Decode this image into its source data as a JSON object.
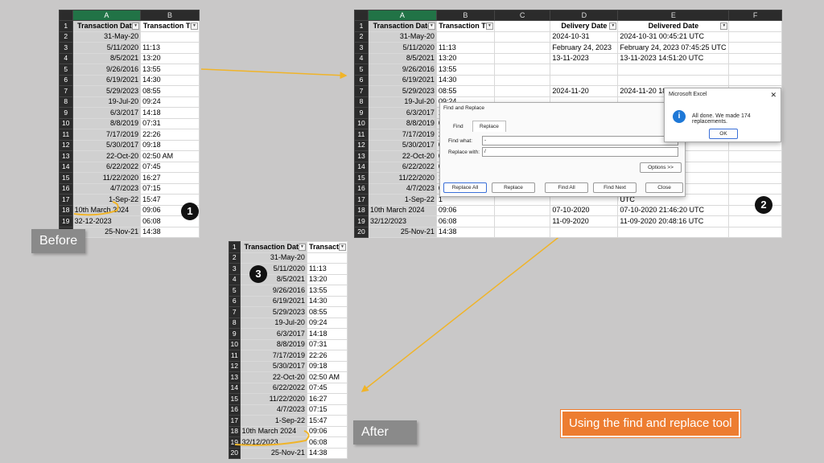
{
  "colors": {
    "arrow": "#f0b429",
    "accent": "#ed7d31",
    "excel_green": "#217346"
  },
  "panel1": {
    "col_letters": [
      "A",
      "B"
    ],
    "headers": [
      "Transaction Date",
      "Transaction Tin"
    ],
    "rows": [
      [
        "31-May-20",
        ""
      ],
      [
        "5/11/2020",
        "11:13"
      ],
      [
        "8/5/2021",
        "13:20"
      ],
      [
        "9/26/2016",
        "13:55"
      ],
      [
        "6/19/2021",
        "14:30"
      ],
      [
        "5/29/2023",
        "08:55"
      ],
      [
        "19-Jul-20",
        "09:24"
      ],
      [
        "6/3/2017",
        "14:18"
      ],
      [
        "8/8/2019",
        "07:31"
      ],
      [
        "7/17/2019",
        "22:26"
      ],
      [
        "5/30/2017",
        "09:18"
      ],
      [
        "22-Oct-20",
        "02:50 AM"
      ],
      [
        "6/22/2022",
        "07:45"
      ],
      [
        "11/22/2020",
        "16:27"
      ],
      [
        "4/7/2023",
        "07:15"
      ],
      [
        "1-Sep-22",
        "15:47"
      ],
      [
        "10th March 2024",
        "09:06"
      ],
      [
        "32-12-2023",
        "06:08"
      ],
      [
        "25-Nov-21",
        "14:38"
      ]
    ],
    "badge": "1"
  },
  "panel2": {
    "col_letters": [
      "A",
      "B",
      "C",
      "D",
      "E",
      "F"
    ],
    "headers": [
      "Transaction Date",
      "Transaction Tin",
      "",
      "Delivery Date",
      "Delivered Date"
    ],
    "rows": [
      [
        "31-May-20",
        "",
        "",
        "2024-10-31",
        "2024-10-31 00:45:21 UTC"
      ],
      [
        "5/11/2020",
        "11:13",
        "",
        "February 24, 2023",
        "February 24, 2023 07:45:25 UTC"
      ],
      [
        "8/5/2021",
        "13:20",
        "",
        "13-11-2023",
        "13-11-2023 14:51:20 UTC"
      ],
      [
        "9/26/2016",
        "13:55",
        "",
        "",
        ""
      ],
      [
        "6/19/2021",
        "14:30",
        "",
        "",
        ""
      ],
      [
        "5/29/2023",
        "08:55",
        "",
        "2024-11-20",
        "2024-11-20 18:..."
      ],
      [
        "19-Jul-20",
        "09:24",
        "",
        "",
        ""
      ],
      [
        "6/3/2017",
        "1",
        "",
        "",
        ""
      ],
      [
        "8/8/2019",
        "0",
        "",
        "",
        ""
      ],
      [
        "7/17/2019",
        "2",
        "",
        "",
        ""
      ],
      [
        "5/30/2017",
        "0",
        "",
        "",
        ""
      ],
      [
        "22-Oct-20",
        "0",
        "",
        "",
        "UTC"
      ],
      [
        "6/22/2022",
        "0",
        "",
        "",
        "UTC"
      ],
      [
        "11/22/2020",
        "1",
        "",
        "",
        "38 UTC"
      ],
      [
        "4/7/2023",
        "0",
        "",
        "",
        "UTC"
      ],
      [
        "1-Sep-22",
        "1",
        "",
        "",
        "UTC"
      ],
      [
        "10th March 2024",
        "09:06",
        "",
        "07-10-2020",
        "07-10-2020 21:46:20 UTC"
      ],
      [
        "32/12/2023",
        "06:08",
        "",
        "11-09-2020",
        "11-09-2020 20:48:16 UTC"
      ],
      [
        "25-Nov-21",
        "14:38",
        "",
        "",
        ""
      ]
    ],
    "badge": "2",
    "find_replace": {
      "title": "Find and Replace",
      "tabs": [
        "Find",
        "Replace"
      ],
      "find_label": "Find what:",
      "find_value": "-",
      "replace_label": "Replace with:",
      "replace_value": "/",
      "options_btn": "Options >>",
      "buttons": [
        "Replace All",
        "Replace",
        "Find All",
        "Find Next",
        "Close"
      ]
    },
    "msgbox": {
      "title": "Microsoft Excel",
      "message": "All done. We made 174 replacements.",
      "ok": "OK",
      "close": "✕"
    }
  },
  "panel3": {
    "headers": [
      "Transaction Date",
      "Transactio"
    ],
    "rows": [
      [
        "31-May-20",
        ""
      ],
      [
        "5/11/2020",
        "11:13"
      ],
      [
        "8/5/2021",
        "13:20"
      ],
      [
        "9/26/2016",
        "13:55"
      ],
      [
        "6/19/2021",
        "14:30"
      ],
      [
        "5/29/2023",
        "08:55"
      ],
      [
        "19-Jul-20",
        "09:24"
      ],
      [
        "6/3/2017",
        "14:18"
      ],
      [
        "8/8/2019",
        "07:31"
      ],
      [
        "7/17/2019",
        "22:26"
      ],
      [
        "5/30/2017",
        "09:18"
      ],
      [
        "22-Oct-20",
        "02:50 AM"
      ],
      [
        "6/22/2022",
        "07:45"
      ],
      [
        "11/22/2020",
        "16:27"
      ],
      [
        "4/7/2023",
        "07:15"
      ],
      [
        "1-Sep-22",
        "15:47"
      ],
      [
        "10th March 2024",
        "09:06"
      ],
      [
        "32/12/2023",
        "06:08"
      ],
      [
        "25-Nov-21",
        "14:38"
      ]
    ],
    "badge": "3"
  },
  "labels": {
    "before": "Before",
    "after": "After",
    "using": "Using the find and replace tool"
  }
}
